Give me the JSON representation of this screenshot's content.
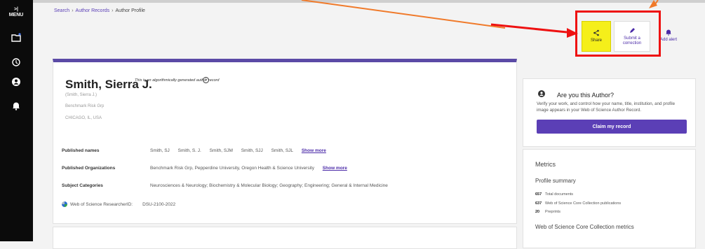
{
  "sidebar": {
    "menu_label": "MENU",
    "toggle_symbol": ">|"
  },
  "breadcrumb": {
    "items": [
      "Search",
      "Author Records"
    ],
    "current": "Author Profile"
  },
  "actions": {
    "share": "Share",
    "submit_correction_line1": "Submit a",
    "submit_correction_line2": "correction",
    "add_alert": "Add alert"
  },
  "profile": {
    "name": "Smith, Sierra J.",
    "algo_note": "This is an algorithmically generated author record",
    "alt_name": "(Smith, Sierra J.)",
    "organization": "Benchmark Risk Grp",
    "location": "CHICAGO, IL, USA",
    "published_names_label": "Published names",
    "published_names": [
      "Smith, SJ",
      "Smith, S. J.",
      "Smith, SJM",
      "Smith, SJJ",
      "Smith, SJL"
    ],
    "published_names_more": "Show more",
    "published_orgs_label": "Published Organizations",
    "published_orgs": "Benchmark Risk Grp,  Pepperdine University,  Oregon Health & Science University",
    "published_orgs_more": "Show more",
    "subject_label": "Subject Categories",
    "subjects": "Neurosciences & Neurology;  Biochemistry & Molecular Biology;  Geography;  Engineering;  General & Internal Medicine",
    "researcher_id_label": "Web of Science ResearcherID:",
    "researcher_id": "DSU-2100-2022"
  },
  "claim": {
    "title": "Are you this Author?",
    "text": "Verify your work, and control how your name, title, institution, and profile image appears in your Web of Science Author Record.",
    "button": "Claim my record"
  },
  "metrics": {
    "title": "Metrics",
    "profile_summary": "Profile summary",
    "stats": [
      {
        "value": "657",
        "label": "Total documents"
      },
      {
        "value": "637",
        "label": "Web of Science Core Collection publications"
      },
      {
        "value": "20",
        "label": "Preprints"
      }
    ],
    "wos_metrics": "Web of Science Core Collection metrics"
  },
  "colors": {
    "accent": "#5b3fb6",
    "highlight": "#f5ef1a",
    "annotation_box": "#e11111",
    "arrow": "#f07a2a"
  }
}
